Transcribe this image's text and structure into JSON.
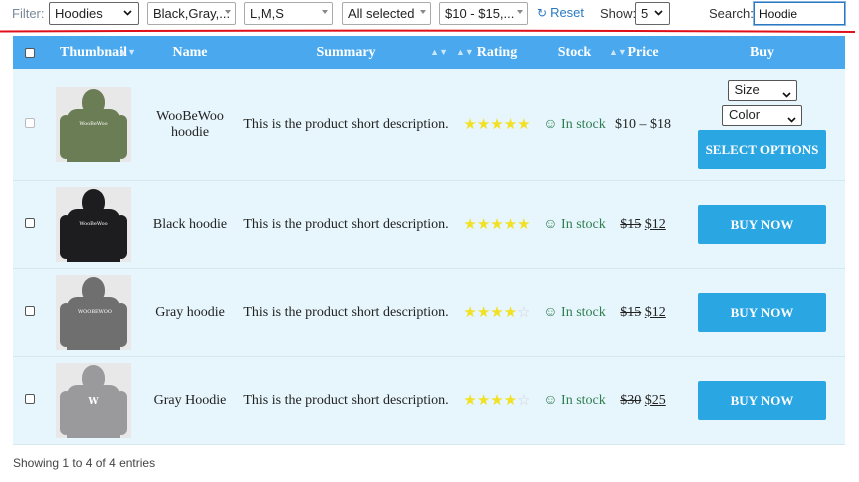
{
  "filters": {
    "label": "Filter:",
    "category": "Hoodies",
    "color": "Black,Gray,...",
    "size": "L,M,S",
    "stock": "All selected",
    "price": "$10 - $15,...",
    "reset_label": "Reset",
    "show_label": "Show:",
    "show_value": "5",
    "search_label": "Search:",
    "search_value": "Hoodie"
  },
  "table": {
    "headers": {
      "thumbnail": "Thumbnail",
      "name": "Name",
      "summary": "Summary",
      "rating": "Rating",
      "stock": "Stock",
      "price": "Price",
      "buy": "Buy"
    },
    "rows": [
      {
        "name": "WooBeWoo hoodie",
        "summary": "This is the product short description.",
        "rating": 5,
        "stock_icon": "☺",
        "stock": "In stock",
        "price_range": "$10 – $18",
        "size_select": "Size",
        "color_select": "Color",
        "button": "SELECT OPTIONS",
        "thumb_color": "#6b7d55",
        "thumb_logo": "WooBeWoo"
      },
      {
        "name": "Black hoodie",
        "summary": "This is the product short description.",
        "rating": 5,
        "stock_icon": "☺",
        "stock": "In stock",
        "old_price": "$15",
        "new_price": "$12",
        "button": "BUY NOW",
        "thumb_color": "#1d1d1f",
        "thumb_logo": "WooBeWoo"
      },
      {
        "name": "Gray hoodie",
        "summary": "This is the product short description.",
        "rating": 4,
        "stock_icon": "☺",
        "stock": "In stock",
        "old_price": "$15",
        "new_price": "$12",
        "button": "BUY NOW",
        "thumb_color": "#6f6f6f",
        "thumb_logo": "WOOBEWOO"
      },
      {
        "name": "Gray Hoodie",
        "summary": "This is the product short description.",
        "rating": 4,
        "stock_icon": "☺",
        "stock": "In stock",
        "old_price": "$30",
        "new_price": "$25",
        "button": "BUY NOW",
        "thumb_color": "#9a9a9c",
        "thumb_logo": "W"
      }
    ]
  },
  "footer": {
    "info": "Showing 1 to 4 of 4 entries"
  },
  "colors": {
    "header_bg": "#4aa9ee",
    "row_bg": "#e7f6fc",
    "button_bg": "#2aa6e3",
    "star": "#f2e023",
    "stock_green": "#2e7d4f",
    "annotation_red": "#e0101a",
    "link_blue": "#2a78c2"
  },
  "icons": {
    "reset": "reset-icon",
    "stock": "smiley-icon",
    "sort": "sort-icon"
  }
}
